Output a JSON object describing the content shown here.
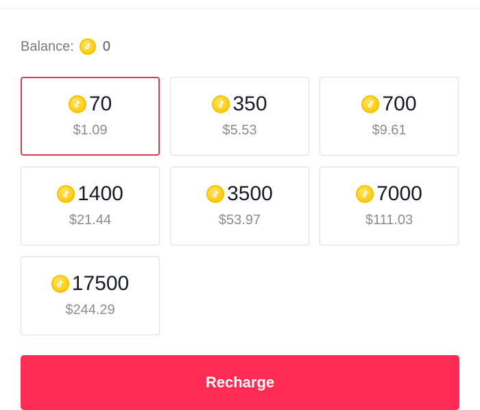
{
  "balance": {
    "label": "Balance:",
    "value": "0",
    "icon": "coin-icon"
  },
  "packages": [
    {
      "coins": "70",
      "price": "$1.09",
      "selected": true
    },
    {
      "coins": "350",
      "price": "$5.53",
      "selected": false
    },
    {
      "coins": "700",
      "price": "$9.61",
      "selected": false
    },
    {
      "coins": "1400",
      "price": "$21.44",
      "selected": false
    },
    {
      "coins": "3500",
      "price": "$53.97",
      "selected": false
    },
    {
      "coins": "7000",
      "price": "$111.03",
      "selected": false
    },
    {
      "coins": "17500",
      "price": "$244.29",
      "selected": false
    }
  ],
  "recharge_button": {
    "label": "Recharge"
  },
  "colors": {
    "accent": "#fe2c55",
    "selected_border": "#d23b5c",
    "coin": "#ffcf1f",
    "text_primary": "#161823",
    "text_secondary": "#8a8b91"
  }
}
